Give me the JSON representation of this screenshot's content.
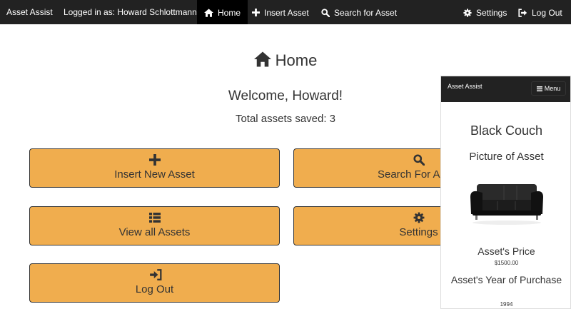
{
  "navbar": {
    "brand": "Asset Assist",
    "logged_in": "Logged in as: Howard Schlottmann",
    "home": {
      "label": "Home",
      "icon": "home-icon",
      "active": true
    },
    "insert": {
      "label": "Insert Asset",
      "icon": "plus-icon"
    },
    "search": {
      "label": "Search for Asset",
      "icon": "search-icon"
    },
    "settings": {
      "label": "Settings",
      "icon": "gear-icon"
    },
    "logout": {
      "label": "Log Out",
      "icon": "logout-icon"
    }
  },
  "main": {
    "title": "Home",
    "welcome": "Welcome, Howard!",
    "total": "Total assets saved: 3",
    "tiles": [
      {
        "label": "Insert New Asset",
        "icon": "plus-icon"
      },
      {
        "label": "Search For Asset",
        "icon": "search-icon"
      },
      {
        "label": "View all Assets",
        "icon": "list-icon"
      },
      {
        "label": "Settings",
        "icon": "gear-icon"
      },
      {
        "label": "Log Out",
        "icon": "login-icon"
      }
    ]
  },
  "preview": {
    "brand": "Asset Assist",
    "menu_label": "Menu",
    "asset_name": "Black Couch",
    "picture_label": "Picture of Asset",
    "price_label": "Asset's Price",
    "price_value": "$1500.00",
    "year_label": "Asset's Year of Purchase",
    "year_value": "1994"
  },
  "colors": {
    "navbar": "#222222",
    "navbar_active": "#000000",
    "tile": "#f0ad4e",
    "tile_border": "#333333",
    "text": "#333333"
  }
}
